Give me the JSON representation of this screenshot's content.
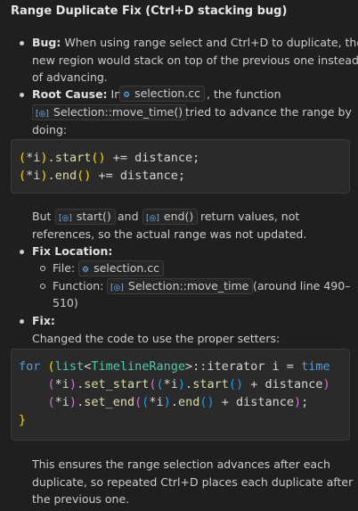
{
  "title": "Range Duplicate Fix (Ctrl+D stacking bug)",
  "bug": {
    "label": "Bug:",
    "line1": "When using range select and Ctrl+D to duplicate, the",
    "line2": "new region would stack on top of the previous one instead",
    "line3": "of advancing."
  },
  "root_cause": {
    "label": "Root Cause:",
    "in_text": "In",
    "file_chip": "selection.cc",
    "the_function": ", the function",
    "func_chip": "Selection::move_time()",
    "after": "tried to advance the range by",
    "doing": "doing:"
  },
  "code1": {
    "line1": {
      "a": "(",
      "b": "*i",
      "c": ")",
      "d": ".",
      "e": "start",
      "f": "()",
      "g": " += distance;"
    },
    "line2": {
      "a": "(",
      "b": "*i",
      "c": ")",
      "d": ".",
      "e": "end",
      "f": "()",
      "g": " += distance;"
    }
  },
  "but_para": {
    "but": "But",
    "chip1": "start()",
    "and": "and",
    "chip2": "end()",
    "after": "return values, not",
    "line2": "references, so the actual range was not updated."
  },
  "fix_location": {
    "label": "Fix Location:",
    "file_label": "File:",
    "file_chip": "selection.cc",
    "function_label": "Function:",
    "function_chip": "Selection::move_time",
    "around": "(around line 490–",
    "around2": "510)"
  },
  "fix": {
    "label": "Fix:",
    "desc": "Changed the code to use the proper setters:"
  },
  "code2": {
    "l1": {
      "kw": "for",
      "sp": " ",
      "p1": "(",
      "ty1": "list",
      "lt": "<",
      "ty2": "TimelineRange",
      "gt": ">",
      "rest": "::iterator i = ",
      "kw2": "time"
    },
    "l2": {
      "ind": "    ",
      "p1": "(",
      "v": "*i",
      "p2": ")",
      "dot": ".",
      "fn": "set_start",
      "p3": "(",
      "p4": "(",
      "v2": "*i",
      "p5": ")",
      "dot2": ".",
      "fn2": "start",
      "p6": "()",
      "rest": " + distance",
      "p7": ")"
    },
    "l3": {
      "ind": "    ",
      "p1": "(",
      "v": "*i",
      "p2": ")",
      "dot": ".",
      "fn": "set_end",
      "p3": "(",
      "p4": "(",
      "v2": "*i",
      "p5": ")",
      "dot2": ".",
      "fn2": "end",
      "p6": "()",
      "rest": " + distance",
      "p7": ")",
      "semi": ";"
    },
    "l4": {
      "brace": "}"
    }
  },
  "summary": {
    "line1": "This ensures the range selection advances after each",
    "line2": "duplicate, so repeated Ctrl+D places each duplicate after",
    "line3": "the previous one."
  },
  "icons": {
    "file_icon": "⚙",
    "symbol_icon": "[◎]"
  }
}
